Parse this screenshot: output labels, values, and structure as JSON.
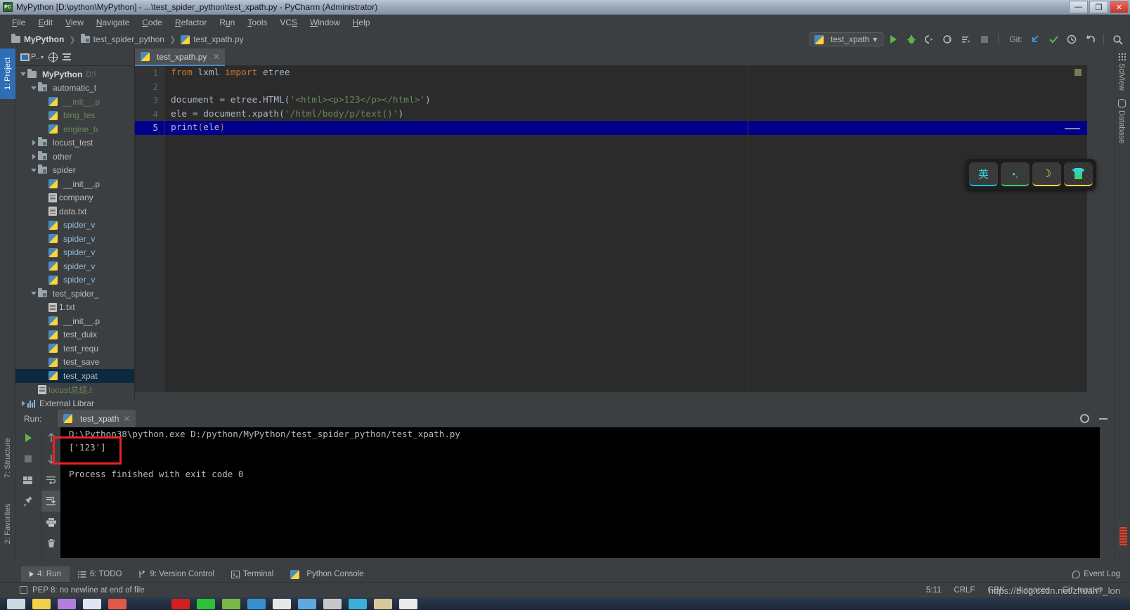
{
  "window": {
    "title": "MyPython [D:\\python\\MyPython] - ...\\test_spider_python\\test_xpath.py - PyCharm (Administrator)",
    "app_icon": "PC",
    "minimize": "—",
    "maximize": "❐",
    "close": "✕"
  },
  "menu": {
    "items": [
      {
        "label": "File"
      },
      {
        "label": "Edit"
      },
      {
        "label": "View"
      },
      {
        "label": "Navigate"
      },
      {
        "label": "Code"
      },
      {
        "label": "Refactor"
      },
      {
        "label": "Run"
      },
      {
        "label": "Tools"
      },
      {
        "label": "VCS"
      },
      {
        "label": "Window"
      },
      {
        "label": "Help"
      }
    ]
  },
  "breadcrumb": {
    "project": "MyPython",
    "folder": "test_spider_python",
    "file": "test_xpath.py"
  },
  "toolbar": {
    "run_config": "test_xpath",
    "dropdown_caret": "▾",
    "git_label": "Git:"
  },
  "left_tool_tabs": [
    {
      "label": "1: Project",
      "selected": true
    },
    {
      "label": "7: Structure",
      "selected": false
    },
    {
      "label": "2: Favorites",
      "selected": false
    }
  ],
  "right_tool_tabs": [
    {
      "label": "SciView"
    },
    {
      "label": "Database"
    }
  ],
  "project_panel": {
    "header_label": "P..",
    "tree": [
      {
        "indent": 0,
        "arrow": "down",
        "icon": "folder",
        "label": "MyPython",
        "suffix": "D:\\",
        "style": "bold"
      },
      {
        "indent": 1,
        "arrow": "down",
        "icon": "folder-mod",
        "label": "automatic_t",
        "style": "plain"
      },
      {
        "indent": 2,
        "arrow": "none",
        "icon": "python",
        "label": "__init__.p",
        "style": "green"
      },
      {
        "indent": 2,
        "arrow": "none",
        "icon": "python",
        "label": "bing_tes",
        "style": "green"
      },
      {
        "indent": 2,
        "arrow": "none",
        "icon": "python",
        "label": "engine_b",
        "style": "green"
      },
      {
        "indent": 1,
        "arrow": "right",
        "icon": "folder-mod",
        "label": "locust_test",
        "style": "plain"
      },
      {
        "indent": 1,
        "arrow": "right",
        "icon": "folder-mod",
        "label": "other",
        "style": "plain"
      },
      {
        "indent": 1,
        "arrow": "down",
        "icon": "folder-mod",
        "label": "spider",
        "style": "plain"
      },
      {
        "indent": 2,
        "arrow": "none",
        "icon": "python",
        "label": "__init__.p",
        "style": "plain"
      },
      {
        "indent": 2,
        "arrow": "none",
        "icon": "text",
        "label": "company",
        "style": "plain"
      },
      {
        "indent": 2,
        "arrow": "none",
        "icon": "text",
        "label": "data.txt",
        "style": "plain"
      },
      {
        "indent": 2,
        "arrow": "none",
        "icon": "python",
        "label": "spider_v",
        "style": "blue"
      },
      {
        "indent": 2,
        "arrow": "none",
        "icon": "python",
        "label": "spider_v",
        "style": "blue"
      },
      {
        "indent": 2,
        "arrow": "none",
        "icon": "python",
        "label": "spider_v",
        "style": "blue"
      },
      {
        "indent": 2,
        "arrow": "none",
        "icon": "python",
        "label": "spider_v",
        "style": "blue"
      },
      {
        "indent": 2,
        "arrow": "none",
        "icon": "python",
        "label": "spider_v",
        "style": "blue"
      },
      {
        "indent": 1,
        "arrow": "down",
        "icon": "folder-mod",
        "label": "test_spider_",
        "style": "plain"
      },
      {
        "indent": 2,
        "arrow": "none",
        "icon": "text",
        "label": "1.txt",
        "style": "plain"
      },
      {
        "indent": 2,
        "arrow": "none",
        "icon": "python",
        "label": "__init__.p",
        "style": "plain"
      },
      {
        "indent": 2,
        "arrow": "none",
        "icon": "python",
        "label": "test_duix",
        "style": "plain"
      },
      {
        "indent": 2,
        "arrow": "none",
        "icon": "python",
        "label": "test_requ",
        "style": "plain"
      },
      {
        "indent": 2,
        "arrow": "none",
        "icon": "python",
        "label": "test_save",
        "style": "plain"
      },
      {
        "indent": 2,
        "arrow": "none",
        "icon": "python",
        "label": "test_xpat",
        "style": "plain",
        "selected": true
      },
      {
        "indent": 1,
        "arrow": "none",
        "icon": "text",
        "label": "locust总结.t",
        "style": "green"
      },
      {
        "indent": 0,
        "arrow": "right",
        "icon": "library",
        "label": "External Librar",
        "style": "plain"
      }
    ]
  },
  "editor": {
    "tab": {
      "label": "test_xpath.py",
      "close": "✕"
    },
    "lines": [
      {
        "n": "1",
        "tokens": [
          {
            "t": "from",
            "c": "kw"
          },
          {
            "t": " lxml ",
            "c": ""
          },
          {
            "t": "import",
            "c": "kw"
          },
          {
            "t": " etree",
            "c": ""
          }
        ]
      },
      {
        "n": "2",
        "tokens": []
      },
      {
        "n": "3",
        "tokens": [
          {
            "t": "document = etree.HTML(",
            "c": ""
          },
          {
            "t": "'<html><p>123</p></html>'",
            "c": "str"
          },
          {
            "t": ")",
            "c": ""
          }
        ]
      },
      {
        "n": "4",
        "tokens": [
          {
            "t": "ele = document.xpath(",
            "c": ""
          },
          {
            "t": "'/html/body/p/text()'",
            "c": "str"
          },
          {
            "t": ")",
            "c": ""
          }
        ]
      },
      {
        "n": "5",
        "current": true,
        "tokens": [
          {
            "t": "print",
            "c": "fn"
          },
          {
            "t": "(",
            "c": "par"
          },
          {
            "t": "ele",
            "c": ""
          },
          {
            "t": ")",
            "c": "par"
          }
        ]
      }
    ]
  },
  "run_panel": {
    "label": "Run:",
    "tab": "test_xpath",
    "tab_close": "✕",
    "output": [
      "D:\\Python38\\python.exe D:/python/MyPython/test_spider_python/test_xpath.py",
      "['123']",
      "",
      "Process finished with exit code 0"
    ],
    "highlighted_output": "['123']",
    "highlight_color": "#ee2222"
  },
  "bottom_bar": {
    "tabs": [
      {
        "label": "4: Run",
        "underline": "4",
        "selected": true
      },
      {
        "label": "6: TODO",
        "underline": "6",
        "selected": false
      },
      {
        "label": "9: Version Control",
        "underline": "9",
        "selected": false
      },
      {
        "label": "Terminal",
        "underline": "",
        "selected": false
      },
      {
        "label": "Python Console",
        "underline": "",
        "selected": false
      }
    ],
    "event_log": "Event Log"
  },
  "status_bar": {
    "message": "PEP 8: no newline at end of file",
    "caret": "5:11",
    "line_sep": "CRLF",
    "encoding": "GBK",
    "indent": "4 spaces",
    "git_branch": "Git: master",
    "watermark": "https://blog.csdn.net/zhuan?_lon"
  },
  "ime_bar": {
    "keys": [
      {
        "glyph": "英",
        "name": "language-toggle"
      },
      {
        "glyph": "•,",
        "name": "punctuation-toggle"
      },
      {
        "glyph": "☽",
        "name": "moon-mode"
      },
      {
        "glyph": "",
        "name": "skin-theme"
      }
    ]
  },
  "taskbar": {
    "items": [
      "app1",
      "app2",
      "app3",
      "app4",
      "app5",
      "app6",
      "app7",
      "app8",
      "app9",
      "app10",
      "app11",
      "app12",
      "app13",
      "app14",
      "app15"
    ]
  },
  "colors": {
    "accent_blue": "#4a88c7",
    "selection_navy": "#00008b",
    "keyword_orange": "#cc7832",
    "string_green": "#6a8759",
    "panel_bg": "#3c3f41",
    "editor_bg": "#2b2b2b"
  }
}
